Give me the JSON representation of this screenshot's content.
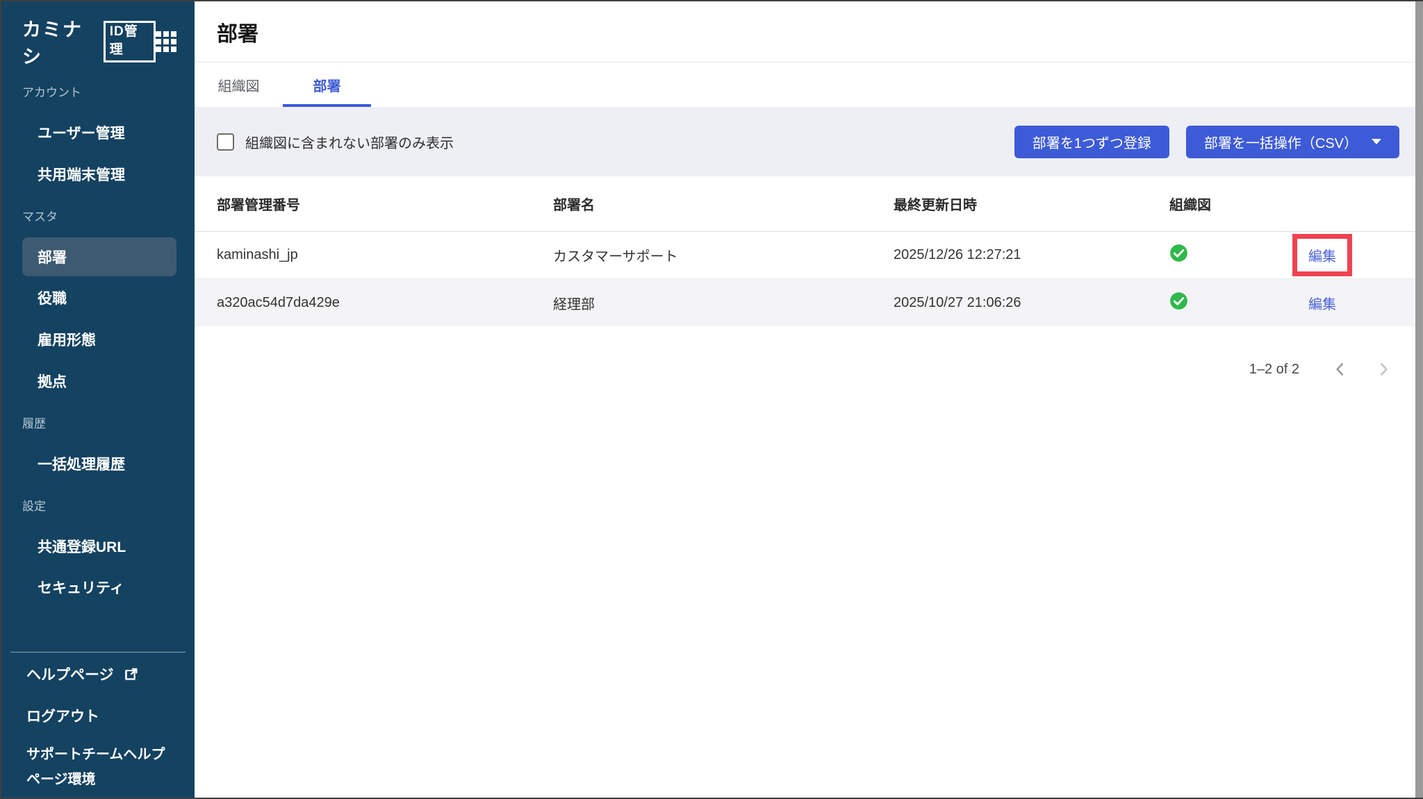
{
  "sidebar": {
    "logo": {
      "brand": "カミナシ",
      "badge": "ID管理"
    },
    "sections": [
      {
        "label": "アカウント",
        "items": [
          {
            "label": "ユーザー管理"
          },
          {
            "label": "共用端末管理"
          }
        ]
      },
      {
        "label": "マスタ",
        "items": [
          {
            "label": "部署",
            "active": true
          },
          {
            "label": "役職"
          },
          {
            "label": "雇用形態"
          },
          {
            "label": "拠点"
          }
        ]
      },
      {
        "label": "履歴",
        "items": [
          {
            "label": "一括処理履歴"
          }
        ]
      },
      {
        "label": "設定",
        "items": [
          {
            "label": "共通登録URL"
          },
          {
            "label": "セキュリティ"
          }
        ]
      }
    ],
    "footer_items": [
      {
        "label": "ヘルプページ",
        "external": true
      },
      {
        "label": "ログアウト"
      },
      {
        "label": "サポートチームヘルプページ環境"
      }
    ]
  },
  "header": {
    "title": "部署"
  },
  "tabs": [
    {
      "label": "組織図",
      "active": false
    },
    {
      "label": "部署",
      "active": true
    }
  ],
  "filter": {
    "checkbox_label": "組織図に含まれない部署のみ表示",
    "checked": false
  },
  "actions": {
    "register_button": "部署を1つずつ登録",
    "bulk_button": "部署を一括操作（CSV）"
  },
  "table": {
    "columns": [
      "部署管理番号",
      "部署名",
      "最終更新日時",
      "組織図"
    ],
    "edit_label": "編集",
    "rows": [
      {
        "id": "kaminashi_jp",
        "name": "カスタマーサポート",
        "updated": "2025/12/26 12:27:21",
        "in_org_chart": true,
        "annotated": true
      },
      {
        "id": "a320ac54d7da429e",
        "name": "経理部",
        "updated": "2025/10/27 21:06:26",
        "in_org_chart": true,
        "annotated": false
      }
    ]
  },
  "pagination": {
    "range_label": "1–2 of 2"
  },
  "colors": {
    "sidebar_bg": "#144261",
    "sidebar_active_bg": "#3D5A73",
    "accent_blue": "#3D5BD7",
    "edit_link_blue": "#4B63DB",
    "filter_bg": "#EDEFF4",
    "check_green": "#2FB84B",
    "annotation_red": "#EF4350"
  }
}
